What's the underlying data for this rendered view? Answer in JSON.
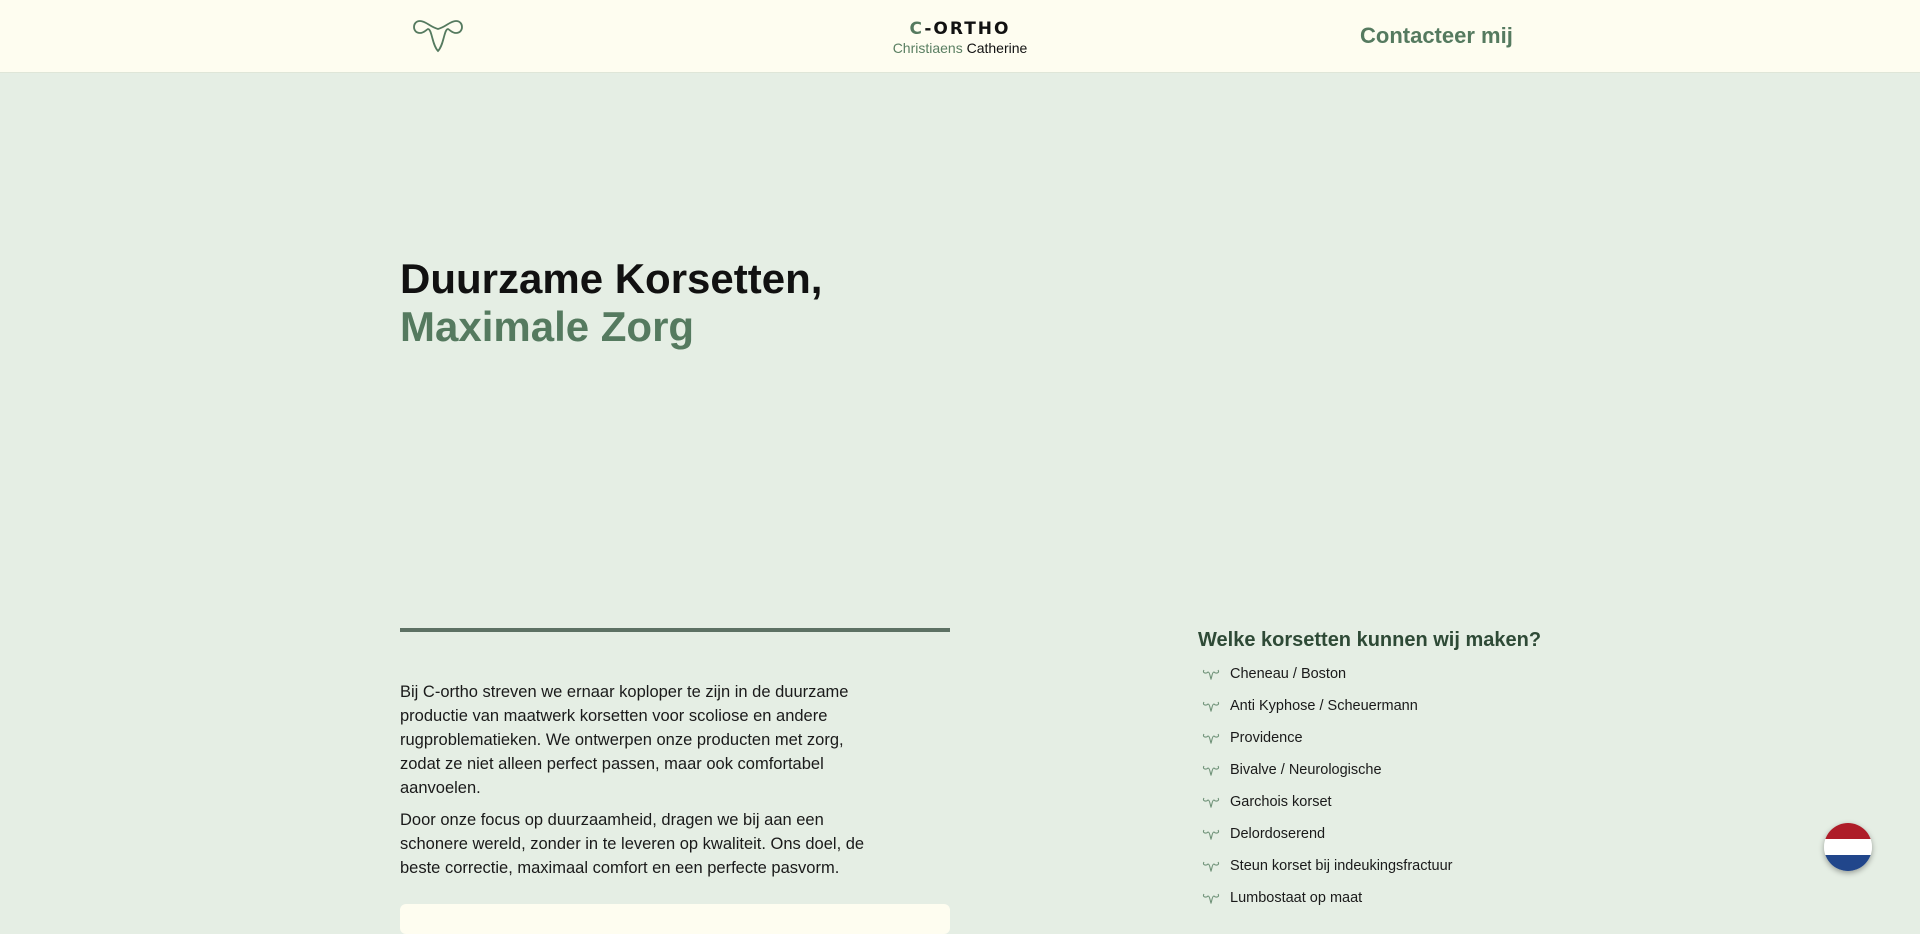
{
  "header": {
    "logo_icon": "cortho-loop-icon",
    "brand": {
      "wordmark_accent": "C",
      "wordmark_rest": "-ORTHO",
      "sub_first": "Christiaens",
      "sub_last": "Catherine"
    },
    "contact_label": "Contacteer mij"
  },
  "hero": {
    "title_line1": "Duurzame Korsetten,",
    "title_line2": "Maximale Zorg"
  },
  "intro": {
    "paragraph1": "Bij C-ortho streven we ernaar koploper te zijn in de duurzame productie van maatwerk korsetten voor scoliose en andere rugproblematieken. We ontwerpen onze producten met zorg, zodat ze niet alleen perfect passen, maar ook comfortabel aanvoelen.",
    "paragraph2": "Door onze focus op duurzaamheid, dragen we bij aan een schonere wereld, zonder in te leveren op kwaliteit. Ons doel, de beste correctie, maximaal comfort en een perfecte pasvorm."
  },
  "types": {
    "heading": "Welke korsetten kunnen wij maken?",
    "items": [
      "Cheneau / Boston",
      "Anti Kyphose / Scheuermann",
      "Providence",
      "Bivalve / Neurologische",
      "Garchois korset",
      "Delordoserend",
      "Steun korset bij indeukingsfractuur",
      "Lumbostaat op maat"
    ]
  },
  "language": {
    "icon": "netherlands-flag-icon",
    "colors": [
      "#ae1c28",
      "#ffffff",
      "#21468b"
    ]
  },
  "colors": {
    "accent": "#557a5f",
    "header_bg": "#fefdf0",
    "page_bg": "#e5eee4"
  }
}
